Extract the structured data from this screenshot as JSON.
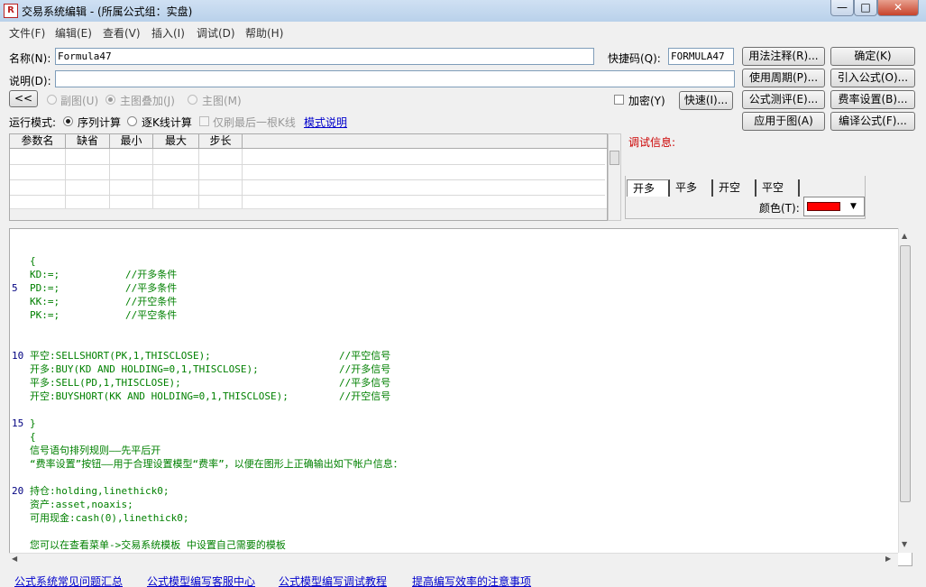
{
  "window": {
    "title": "交易系统编辑 - (所属公式组：实盘)",
    "min": "—",
    "max": "□",
    "close": "✕"
  },
  "menu": [
    "文件(F)",
    "编辑(E)",
    "查看(V)",
    "插入(I)",
    "调试(D)",
    "帮助(H)"
  ],
  "form": {
    "name_label": "名称(N):",
    "name_value": "Formula47",
    "shortcut_label": "快捷码(Q):",
    "shortcut_value": "FORMULA47",
    "desc_label": "说明(D):",
    "desc_value": "",
    "collapse_btn": "<<",
    "opt_sub": "副图(U)",
    "opt_overlay": "主图叠加(J)",
    "opt_main": "主图(M)",
    "encrypt_label": "加密(Y)",
    "quick_btn": "快速(I)...",
    "run_mode_label": "运行模式:",
    "run_seq": "序列计算",
    "run_kline": "逐K线计算",
    "run_last": "仅刷最后一根K线",
    "mode_help": "模式说明"
  },
  "buttons": {
    "syntax": "用法注释(R)...",
    "ok": "确定(K)",
    "period": "使用周期(P)...",
    "import": "引入公式(O)...",
    "test": "公式测评(E)...",
    "fee": "费率设置(B)...",
    "apply": "应用于图(A)",
    "compile": "编译公式(F)..."
  },
  "params": {
    "headers": [
      "参数名",
      "缺省",
      "最小",
      "最大",
      "步长"
    ]
  },
  "debug": {
    "label": "调试信息:",
    "tabs": [
      "开多",
      "平多",
      "开空",
      "平空"
    ],
    "color_label": "颜色(T):",
    "color_value": "#ff0000"
  },
  "code": [
    {
      "n": "",
      "t": "{",
      "c": ""
    },
    {
      "n": "",
      "t": "KD:=;",
      "c": "//开多条件"
    },
    {
      "n": "5",
      "t": "PD:=;",
      "c": "//平多条件"
    },
    {
      "n": "",
      "t": "KK:=;",
      "c": "//开空条件"
    },
    {
      "n": "",
      "t": "PK:=;",
      "c": "//平空条件"
    },
    {
      "n": "",
      "t": "",
      "c": ""
    },
    {
      "n": "",
      "t": "",
      "c": ""
    },
    {
      "n": "10",
      "t": "平空:SELLSHORT(PK,1,THISCLOSE);",
      "c": "//平空信号"
    },
    {
      "n": "",
      "t": "开多:BUY(KD AND HOLDING=0,1,THISCLOSE);",
      "c": "//开多信号"
    },
    {
      "n": "",
      "t": "平多:SELL(PD,1,THISCLOSE);",
      "c": "//平多信号"
    },
    {
      "n": "",
      "t": "开空:BUYSHORT(KK AND HOLDING=0,1,THISCLOSE);",
      "c": "//开空信号"
    },
    {
      "n": "",
      "t": "",
      "c": ""
    },
    {
      "n": "15",
      "t": "}",
      "c": ""
    },
    {
      "n": "",
      "t": "{",
      "c": ""
    },
    {
      "n": "",
      "t": "信号语句排列规则——先平后开",
      "c": ""
    },
    {
      "n": "",
      "t": "“费率设置”按钮——用于合理设置模型“费率”，以便在图形上正确输出如下帐户信息：",
      "c": ""
    },
    {
      "n": "",
      "t": "",
      "c": ""
    },
    {
      "n": "20",
      "t": "持仓:holding,linethick0;",
      "c": ""
    },
    {
      "n": "",
      "t": "资产:asset,noaxis;",
      "c": ""
    },
    {
      "n": "",
      "t": "可用现金:cash(0),linethick0;",
      "c": ""
    },
    {
      "n": "",
      "t": "",
      "c": ""
    },
    {
      "n": "",
      "t": "您可以在查看菜单->交易系统模板 中设置自己需要的模板",
      "c": ""
    }
  ],
  "footer": [
    "公式系统常见问题汇总",
    "公式模型编写客服中心",
    "公式模型编写调试教程",
    "提高编写效率的注意事项"
  ]
}
